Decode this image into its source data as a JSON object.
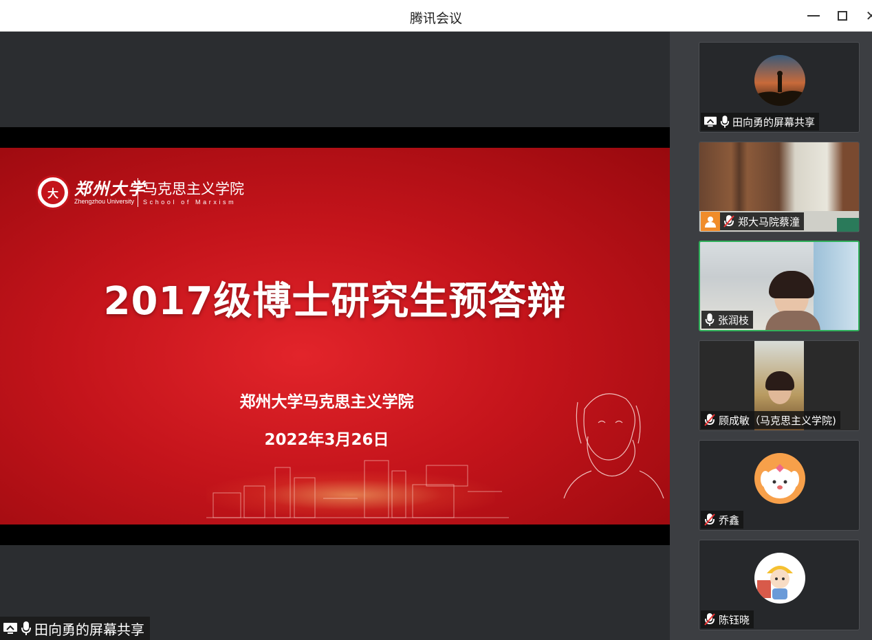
{
  "window": {
    "title": "腾讯会议"
  },
  "slide": {
    "logo_cn": "郑州大学",
    "logo_en": "Zhengzhou University",
    "school_cn": "马克思主义学院",
    "school_en": "School of Marxism",
    "emblem_text": "大",
    "title": "2017级博士研究生预答辩",
    "subtitle": "郑州大学马克思主义学院",
    "date": "2022年3月26日"
  },
  "share_label": "田向勇的屏幕共享",
  "participants": [
    {
      "name": "田向勇的屏幕共享",
      "mic": "on",
      "screen_share": true,
      "view": "avatar-silhouette"
    },
    {
      "name": "郑大马院蔡潼",
      "mic": "muted",
      "badge": "user-icon",
      "view": "video-room"
    },
    {
      "name": "张润枝",
      "mic": "on",
      "speaking": true,
      "view": "video-person"
    },
    {
      "name": "顾成敏（马克思主义学院)",
      "mic": "muted",
      "view": "video-person"
    },
    {
      "name": "乔鑫",
      "mic": "muted",
      "view": "avatar-cartoon-dog"
    },
    {
      "name": "陈钰晓",
      "mic": "muted",
      "view": "avatar-cartoon-girl"
    }
  ],
  "colors": {
    "accent_speaking": "#2fb05a",
    "slide_red": "#c4141b",
    "badge_orange": "#f08c2a"
  }
}
